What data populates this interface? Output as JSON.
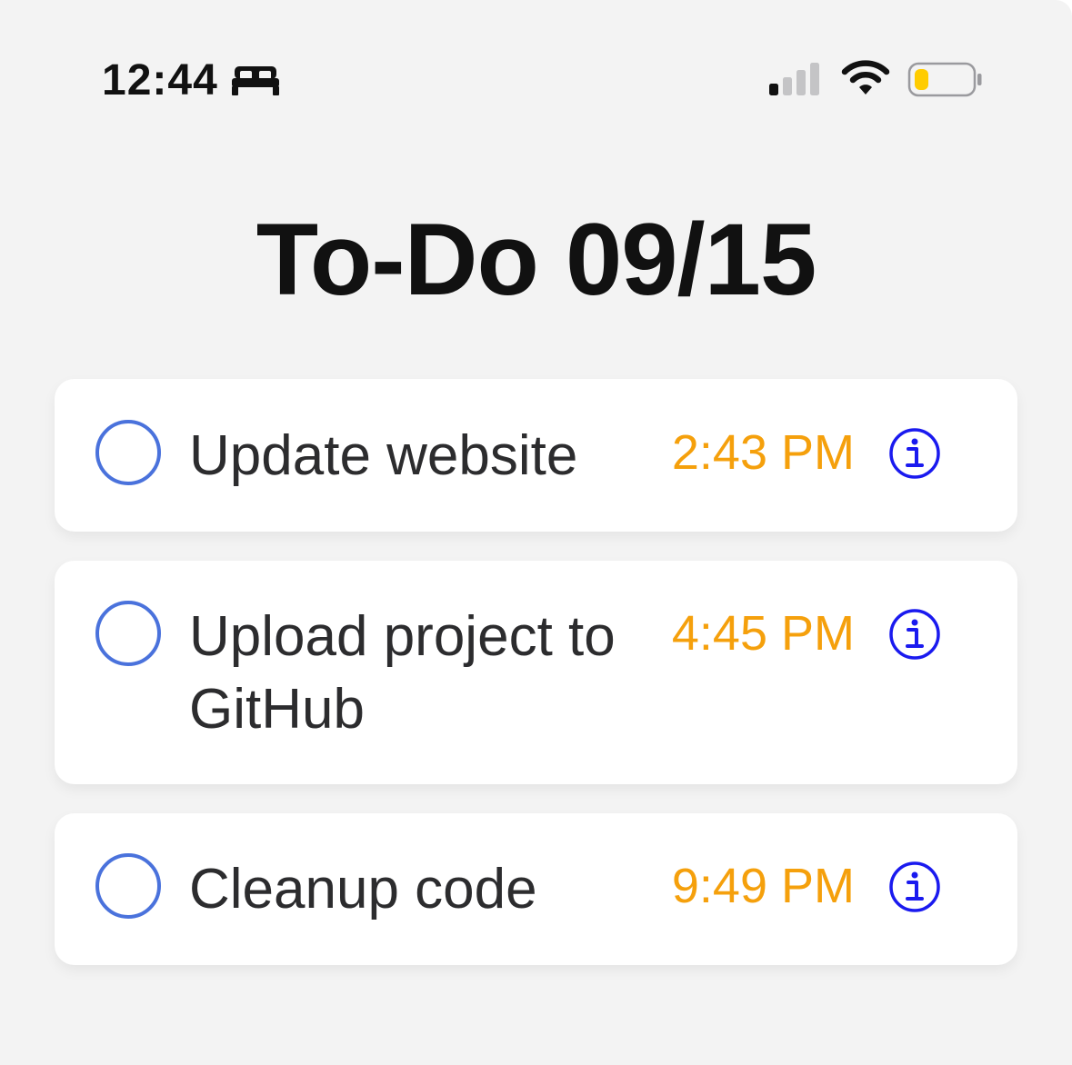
{
  "status_bar": {
    "time": "12:44",
    "focus_icon": "bed-icon",
    "signal_icon": "cellular-signal-icon",
    "wifi_icon": "wifi-icon",
    "battery_icon": "battery-icon",
    "battery_color": "#ffcc00",
    "battery_level": 0.25
  },
  "header": {
    "title": "To-Do 09/15"
  },
  "tasks": [
    {
      "title": "Update website",
      "time": "2:43 PM",
      "completed": false,
      "info_icon": "info-icon"
    },
    {
      "title": "Upload project to GitHub",
      "time": "4:45 PM",
      "completed": false,
      "info_icon": "info-icon"
    },
    {
      "title": "Cleanup code",
      "time": "9:49 PM",
      "completed": false,
      "info_icon": "info-icon"
    }
  ],
  "colors": {
    "background": "#f3f3f3",
    "card": "#ffffff",
    "checkbox_border": "#4a72dc",
    "time_text": "#f5a00c",
    "info_icon": "#1a1aef",
    "title_text": "#111111",
    "task_text": "#2c2c2e"
  }
}
